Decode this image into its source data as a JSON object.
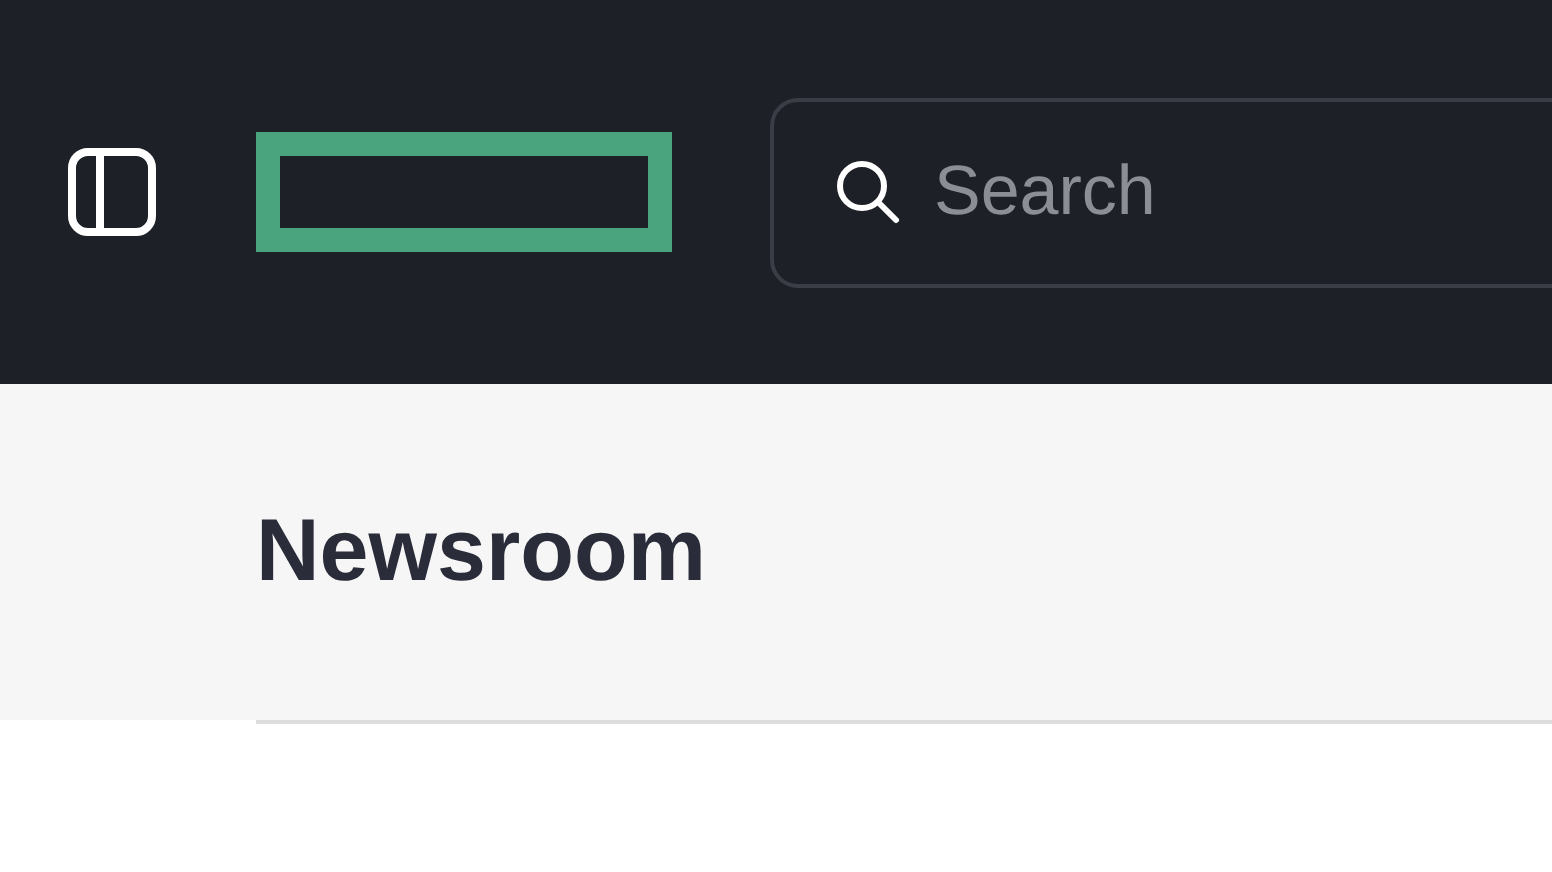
{
  "search": {
    "placeholder": "Search"
  },
  "page": {
    "title": "Newsroom"
  }
}
